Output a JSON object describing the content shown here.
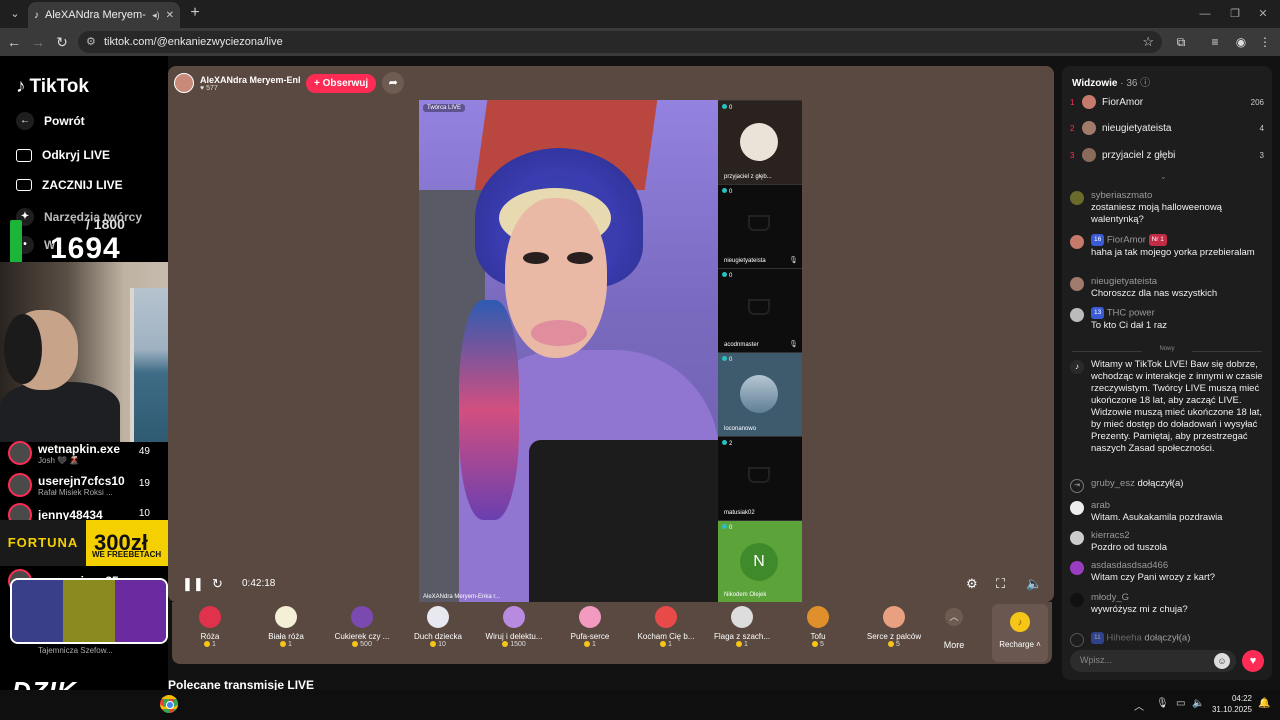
{
  "browser": {
    "tab_title": "AleXANdra Meryem-Enka",
    "url": "tiktok.com/@enkaniezwyciezona/live"
  },
  "sidebar": {
    "brand": "TikTok",
    "back_label": "Powrót",
    "items": [
      {
        "label": "Odkryj LIVE"
      },
      {
        "label": "ZACZNIJ LIVE"
      },
      {
        "label": "Narzędzia twórcy"
      },
      {
        "label": "W"
      }
    ]
  },
  "overlay": {
    "counter_value": "1694",
    "counter_max": "/ 1800",
    "fortuna_logo": "FORTUNA",
    "fortuna_amount": "300zł",
    "fortuna_sub": "WE FREEBETACH",
    "dzik": "DZIK"
  },
  "live_list": [
    {
      "name": "wetnapkin.exe",
      "sub": "Josh 🖤 🌋",
      "count": "49"
    },
    {
      "name": "userejn7cfcs10",
      "sub": "Rafał Misiek Roksi ...",
      "count": "19"
    },
    {
      "name": "jenny48434",
      "sub": "",
      "count": "10"
    },
    {
      "name": "agus.erison85",
      "sub": "",
      "count": ""
    },
    {
      "name": "",
      "sub": "Tajemnicza Szefow...",
      "count": ""
    }
  ],
  "stream": {
    "host_name": "AleXANdra Meryem-Enk...",
    "host_likes": "577",
    "follow_label": "+ Obserwuj",
    "video_tag": "Twórca LIVE",
    "video_caption": "AleXANdra Meryem-Enka r...",
    "time": "0:42:18",
    "guests": [
      {
        "count": "0",
        "name": "przyjaciel z głęb..."
      },
      {
        "count": "0",
        "name": "nieugietyateista"
      },
      {
        "count": "0",
        "name": "acodnmaster"
      },
      {
        "count": "0",
        "name": "loconanowo"
      },
      {
        "count": "2",
        "name": "matusiak02"
      },
      {
        "count": "0",
        "name": "Nikodem Olejek",
        "initial": "N"
      }
    ]
  },
  "gifts": [
    {
      "name": "Róża",
      "price": "1",
      "color": "#e0324a"
    },
    {
      "name": "Biała róża",
      "price": "1",
      "color": "#f4f0d8"
    },
    {
      "name": "Cukierek czy ...",
      "price": "500",
      "color": "#7a4ab0"
    },
    {
      "name": "Duch dziecka",
      "price": "10",
      "color": "#e8e8f0"
    },
    {
      "name": "Wiruj i delektu...",
      "price": "1500",
      "color": "#b88ae0"
    },
    {
      "name": "Pufa-serce",
      "price": "1",
      "color": "#f29ac0"
    },
    {
      "name": "Kocham Cię b...",
      "price": "1",
      "color": "#e84a4a"
    },
    {
      "name": "Flaga z szach...",
      "price": "1",
      "color": "#dddddd"
    },
    {
      "name": "Tofu",
      "price": "5",
      "color": "#e0902a"
    },
    {
      "name": "Serce z palców",
      "price": "5",
      "color": "#e8a080"
    }
  ],
  "gift_more": "More",
  "recharge": "Recharge",
  "recommended": "Polecane transmisje LIVE",
  "chat": {
    "viewers_label": "Widzowie",
    "viewers_count": "· 36",
    "top": [
      {
        "rank": "1",
        "name": "FiorAmor",
        "score": "206"
      },
      {
        "rank": "2",
        "name": "nieugietyateista",
        "score": "4"
      },
      {
        "rank": "3",
        "name": "przyjaciel z głębi",
        "score": "3"
      }
    ],
    "messages": [
      {
        "user": "syberiaszmato",
        "text": "zostaniesz moją halloweenową walentynką?"
      },
      {
        "user": "FiorAmor",
        "badge": "16",
        "badge2": "Nr 1",
        "text": "haha ja tak mojego yorka przebieralam"
      },
      {
        "user": "nieugietyateista",
        "text": "Choroszcz dla nas wszystkich"
      },
      {
        "user": "THC power",
        "badge": "13",
        "text": "To kto Ci dał 1 raz"
      }
    ],
    "divider": "Nowy",
    "system": "Witamy w TikTok LIVE! Baw się dobrze, wchodząc w interakcje z innymi w czasie rzeczywistym. Twórcy LIVE muszą mieć ukończone 18 lat, aby zacząć LIVE. Widzowie muszą mieć ukończone 18 lat, by mieć dostęp do doładowań i wysyłać Prezenty. Pamiętaj, aby przestrzegać naszych Zasad społeczności.",
    "joined_user": "gruby_esz",
    "joined_text": "dołączył(a)",
    "messages2": [
      {
        "user": "arab",
        "text": "Witam. Asukakamila pozdrawia"
      },
      {
        "user": "kierracs2",
        "text": "Pozdro od tuszola"
      },
      {
        "user": "asdasdasdsad466",
        "text": "Witam czy Pani wrozy z kart?"
      },
      {
        "user": "młody_G",
        "text": "wywróżysz mi z chuja?"
      }
    ],
    "last_user": "Hiheeha",
    "last_badge": "11",
    "last_text": "dołączył(a)",
    "input_placeholder": "Wpisz..."
  },
  "taskbar": {
    "time": "04:22",
    "date": "31.10.2025"
  }
}
